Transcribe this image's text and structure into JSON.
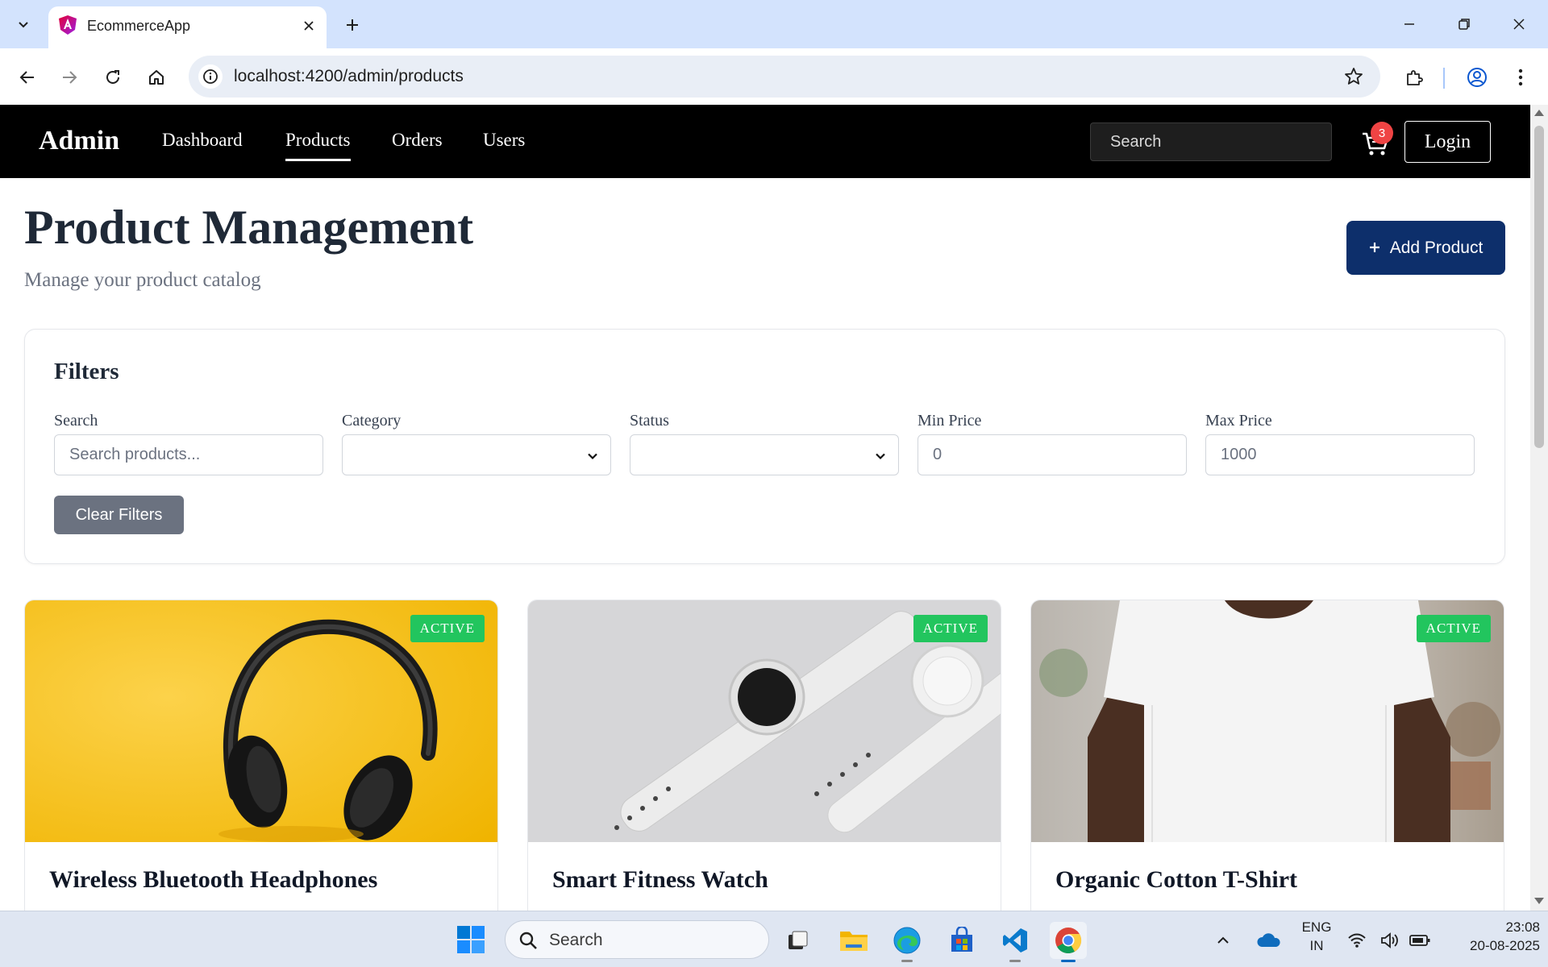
{
  "browser": {
    "tab_title": "EcommerceApp",
    "url": "localhost:4200/admin/products"
  },
  "navbar": {
    "brand": "Admin",
    "links": [
      "Dashboard",
      "Products",
      "Orders",
      "Users"
    ],
    "active_link": "Products",
    "search_placeholder": "Search",
    "cart_count": "3",
    "login_label": "Login"
  },
  "header": {
    "title": "Product Management",
    "subtitle": "Manage your product catalog",
    "add_button_label": "Add Product"
  },
  "filters": {
    "title": "Filters",
    "search_label": "Search",
    "search_placeholder": "Search products...",
    "category_label": "Category",
    "category_value": "",
    "status_label": "Status",
    "status_value": "",
    "min_price_label": "Min Price",
    "min_price_placeholder": "0",
    "max_price_label": "Max Price",
    "max_price_placeholder": "1000",
    "clear_label": "Clear Filters"
  },
  "products": [
    {
      "name": "Wireless Bluetooth Headphones",
      "status": "ACTIVE"
    },
    {
      "name": "Smart Fitness Watch",
      "status": "ACTIVE"
    },
    {
      "name": "Organic Cotton T-Shirt",
      "status": "ACTIVE"
    }
  ],
  "colors": {
    "nav_bg": "#000000",
    "primary": "#0d2f6b",
    "active_badge": "#22c55e",
    "cart_badge": "#ef4444",
    "clear_button": "#6b7280"
  },
  "taskbar": {
    "search_placeholder": "Search",
    "lang_line1": "ENG",
    "lang_line2": "IN",
    "time": "23:08",
    "date": "20-08-2025"
  }
}
